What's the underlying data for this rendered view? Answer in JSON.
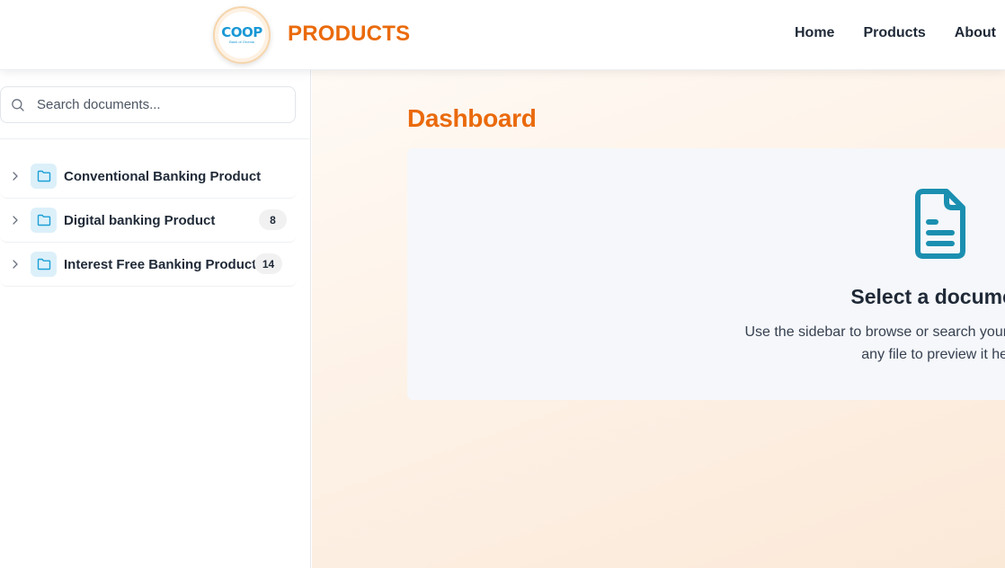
{
  "header": {
    "logo_text": "COOP",
    "logo_subtext": "Bank of Oromia",
    "brand_title": "PRODUCTS",
    "nav": [
      {
        "label": "Home"
      },
      {
        "label": "Products"
      },
      {
        "label": "About"
      }
    ]
  },
  "sidebar": {
    "search": {
      "placeholder": "Search documents..."
    },
    "folders": [
      {
        "label": "Conventional Banking Product",
        "count": ""
      },
      {
        "label": "Digital banking Product",
        "count": "8"
      },
      {
        "label": "Interest Free Banking Product",
        "count": "14"
      }
    ]
  },
  "main": {
    "title": "Dashboard",
    "empty_state": {
      "title": "Select a document",
      "description": "Use the sidebar to browse or search your documents. Click on any file to preview it here."
    }
  },
  "colors": {
    "brand": "#ea6a0c",
    "icon_teal": "#1b8fb0",
    "folder_bg": "#dcf0fa",
    "folder_stroke": "#1a9fd6"
  },
  "icons": {
    "search": "search-icon",
    "chevron": "chevron-right-icon",
    "folder": "folder-icon",
    "document": "document-icon"
  }
}
